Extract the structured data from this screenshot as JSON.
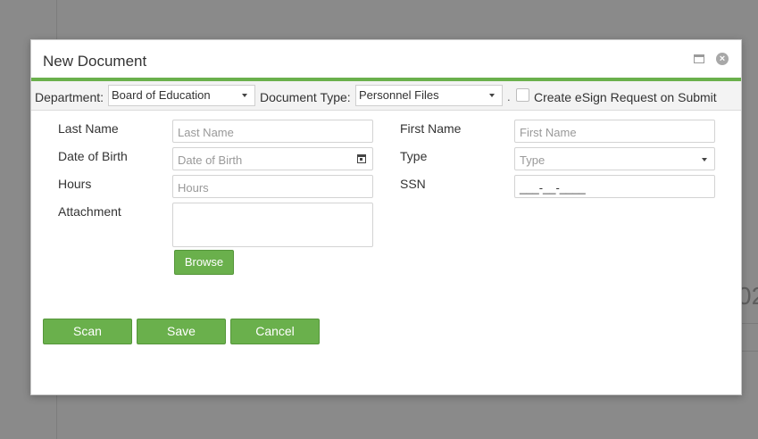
{
  "background": {
    "partial_number": "02"
  },
  "dialog": {
    "title": "New Document",
    "maximize_icon": "maximize-icon",
    "close_icon": "close-icon"
  },
  "toolbar": {
    "department_label": "Department:",
    "department_value": "Board of Education",
    "document_type_label": "Document Type:",
    "document_type_value": "Personnel Files",
    "separator": ".",
    "esign_checked": false,
    "esign_label": "Create eSign Request on Submit"
  },
  "form": {
    "last_name": {
      "label": "Last Name",
      "placeholder": "Last Name"
    },
    "first_name": {
      "label": "First Name",
      "placeholder": "First Name"
    },
    "date_of_birth": {
      "label": "Date of Birth",
      "placeholder": "Date of Birth"
    },
    "type": {
      "label": "Type",
      "placeholder": "Type"
    },
    "hours": {
      "label": "Hours",
      "placeholder": "Hours"
    },
    "ssn": {
      "label": "SSN",
      "mask": "___-__-____"
    },
    "attachment": {
      "label": "Attachment"
    }
  },
  "buttons": {
    "browse": "Browse",
    "scan": "Scan",
    "save": "Save",
    "cancel": "Cancel"
  },
  "colors": {
    "accent": "#6ab04c",
    "overlay": "#8a8a8a"
  }
}
